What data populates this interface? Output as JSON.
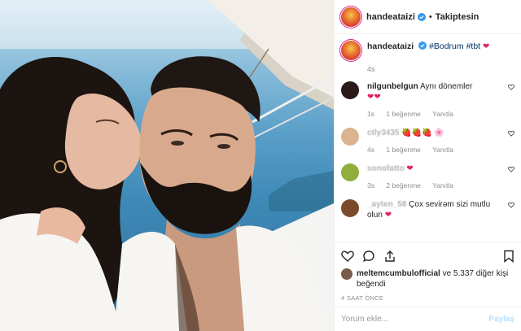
{
  "header": {
    "username": "handeataizi",
    "separator": "•",
    "follow_label": "Takiptesin"
  },
  "caption": {
    "username": "handeataizi",
    "hashtag_1": "#Bodrum",
    "hashtag_2": "#tbt",
    "emoji": "❤",
    "time": "4s"
  },
  "comments": [
    {
      "username": "nilgunbelgun",
      "text": "Aynı dönemler",
      "emoji": "❤❤",
      "time": "1s",
      "likes": "1 beğenme",
      "reply": "Yanıtla",
      "avatar_color": "#2a1a1a"
    },
    {
      "username": "ctly3435",
      "text": "",
      "emoji": "🍓🍓🍓 🌸",
      "time": "4s",
      "likes": "1 beğenme",
      "reply": "Yanıtla",
      "avatar_color": "#d9b48f"
    },
    {
      "username": "sonofatto",
      "text": "",
      "emoji": "❤",
      "time": "3s",
      "likes": "2 beğenme",
      "reply": "Yanıtla",
      "avatar_color": "#8fae3c"
    },
    {
      "username": "_ayten_58",
      "text": "Çox sevirəm sizi mutlu olun",
      "emoji": "❤",
      "time": "",
      "likes": "",
      "reply": "",
      "avatar_color": "#7a4a2a"
    }
  ],
  "likes": {
    "liker": "meltemcumbulofficial",
    "rest": "ve 5.337 diğer kişi",
    "suffix": "beğendi"
  },
  "posted_ago": "4 SAAT ÖNCE",
  "add_comment": {
    "placeholder": "Yorum ekle...",
    "share_label": "Paylaş"
  },
  "colors": {
    "verified_blue": "#3897f0",
    "heart_red": "#ed4956",
    "link_blue": "#003569"
  }
}
